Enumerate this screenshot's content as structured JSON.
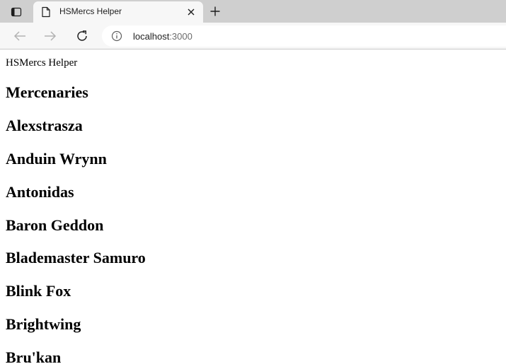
{
  "browser": {
    "tab": {
      "title": "HSMercs Helper"
    },
    "address_bar": {
      "host": "localhost",
      "port": ":3000"
    },
    "icons": {
      "tab_actions": "tab-actions-icon",
      "favicon": "document-icon",
      "close": "close-icon",
      "new_tab": "plus-icon",
      "back": "arrow-left-icon",
      "forward": "arrow-right-icon",
      "refresh": "refresh-icon",
      "site_info": "info-icon"
    }
  },
  "page": {
    "app_title": "HSMercs Helper",
    "section_heading": "Mercenaries",
    "mercenaries": [
      "Alexstrasza",
      "Anduin Wrynn",
      "Antonidas",
      "Baron Geddon",
      "Blademaster Samuro",
      "Blink Fox",
      "Brightwing",
      "Bru'kan"
    ]
  }
}
